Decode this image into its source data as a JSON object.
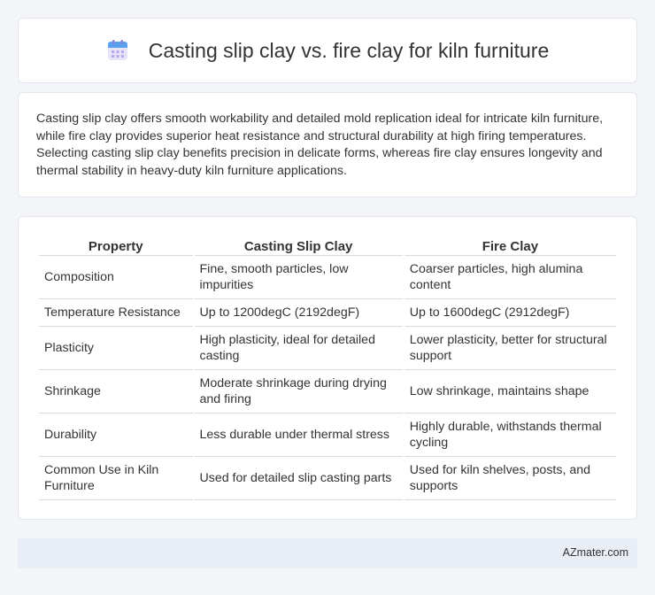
{
  "header": {
    "title": "Casting slip clay vs. fire clay for kiln furniture",
    "icon": "calendar-icon"
  },
  "intro": {
    "text": "Casting slip clay offers smooth workability and detailed mold replication ideal for intricate kiln furniture, while fire clay provides superior heat resistance and structural durability at high firing temperatures. Selecting casting slip clay benefits precision in delicate forms, whereas fire clay ensures longevity and thermal stability in heavy-duty kiln furniture applications."
  },
  "table": {
    "headers": [
      "Property",
      "Casting Slip Clay",
      "Fire Clay"
    ],
    "rows": [
      [
        "Composition",
        "Fine, smooth particles, low impurities",
        "Coarser particles, high alumina content"
      ],
      [
        "Temperature Resistance",
        "Up to 1200degC (2192degF)",
        "Up to 1600degC (2912degF)"
      ],
      [
        "Plasticity",
        "High plasticity, ideal for detailed casting",
        "Lower plasticity, better for structural support"
      ],
      [
        "Shrinkage",
        "Moderate shrinkage during drying and firing",
        "Low shrinkage, maintains shape"
      ],
      [
        "Durability",
        "Less durable under thermal stress",
        "Highly durable, withstands thermal cycling"
      ],
      [
        "Common Use in Kiln Furniture",
        "Used for detailed slip casting parts",
        "Used for kiln shelves, posts, and supports"
      ]
    ]
  },
  "footer": {
    "brand": "AZmater.com"
  }
}
